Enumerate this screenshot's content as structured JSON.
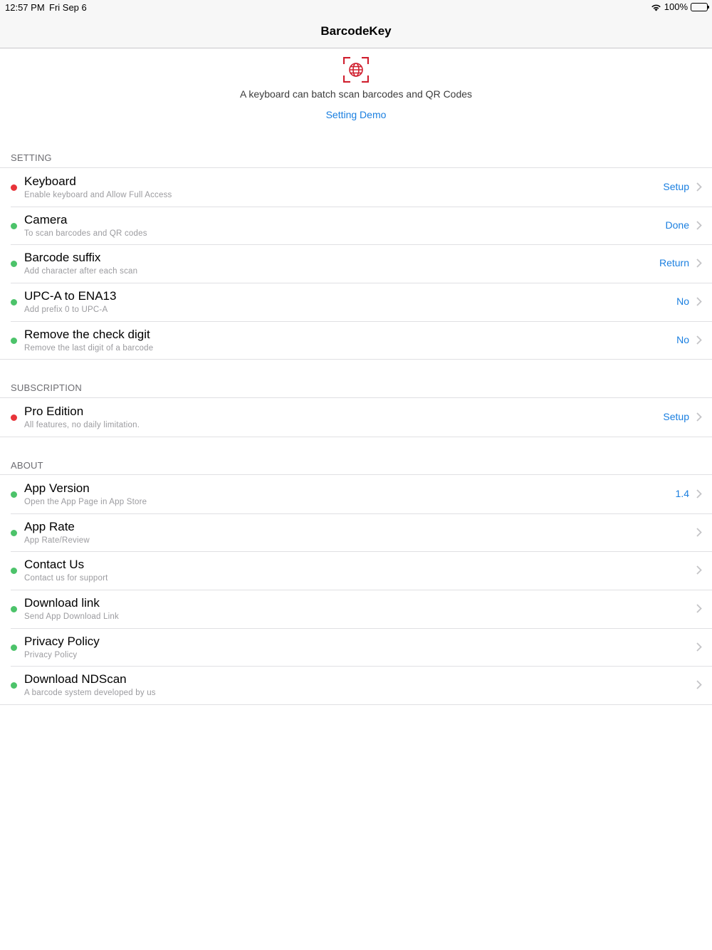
{
  "status": {
    "time": "12:57 PM",
    "date": "Fri Sep 6",
    "battery": "100%"
  },
  "nav": {
    "title": "BarcodeKey"
  },
  "header": {
    "tagline": "A keyboard can batch scan barcodes and QR Codes",
    "demo_link": "Setting Demo"
  },
  "colors": {
    "accent": "#1a7fe0",
    "dot_red": "#e8343a",
    "dot_green": "#4cc36a",
    "logo_red": "#d0202f"
  },
  "sections": {
    "setting": {
      "title": "SETTING",
      "rows": [
        {
          "title": "Keyboard",
          "subtitle": "Enable keyboard and Allow Full Access",
          "value": "Setup",
          "status": "red"
        },
        {
          "title": "Camera",
          "subtitle": "To scan barcodes and QR codes",
          "value": "Done",
          "status": "green"
        },
        {
          "title": "Barcode suffix",
          "subtitle": "Add character after each scan",
          "value": "Return",
          "status": "green"
        },
        {
          "title": "UPC-A to ENA13",
          "subtitle": "Add prefix 0 to UPC-A",
          "value": "No",
          "status": "green"
        },
        {
          "title": "Remove the check digit",
          "subtitle": "Remove the last digit of a barcode",
          "value": "No",
          "status": "green"
        }
      ]
    },
    "subscription": {
      "title": "SUBSCRIPTION",
      "rows": [
        {
          "title": "Pro Edition",
          "subtitle": "All features, no daily limitation.",
          "value": "Setup",
          "status": "red"
        }
      ]
    },
    "about": {
      "title": "ABOUT",
      "rows": [
        {
          "title": "App Version",
          "subtitle": "Open the App Page in App Store",
          "value": "1.4",
          "status": "green"
        },
        {
          "title": "App Rate",
          "subtitle": "App Rate/Review",
          "value": "",
          "status": "green"
        },
        {
          "title": "Contact Us",
          "subtitle": "Contact us for support",
          "value": "",
          "status": "green"
        },
        {
          "title": "Download link",
          "subtitle": "Send App Download Link",
          "value": "",
          "status": "green"
        },
        {
          "title": "Privacy Policy",
          "subtitle": "Privacy Policy",
          "value": "",
          "status": "green"
        },
        {
          "title": "Download NDScan",
          "subtitle": "A barcode system developed by us",
          "value": "",
          "status": "green"
        }
      ]
    }
  }
}
